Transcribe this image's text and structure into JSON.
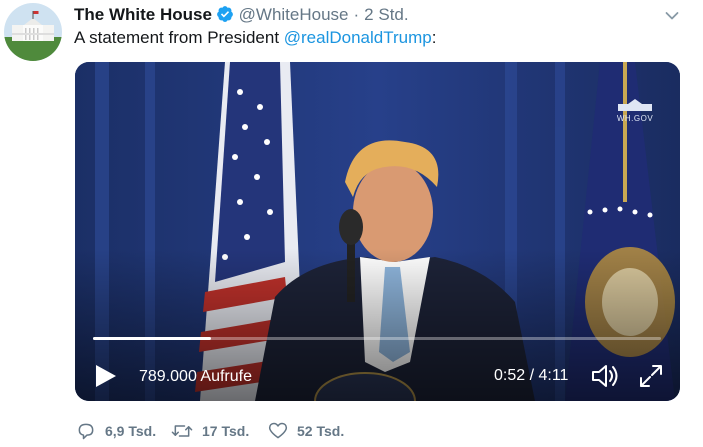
{
  "tweet": {
    "author_name": "The White House",
    "handle": "@WhiteHouse",
    "separator": "·",
    "time": "2 Std.",
    "text_prefix": "A statement from President ",
    "mention": "@realDonaldTrump",
    "text_suffix": ":"
  },
  "video": {
    "views": "789.000 Aufrufe",
    "timecode": "0:52 / 4:11",
    "progress": 0.207,
    "watermark": "WH.GOV"
  },
  "actions": {
    "replies": "6,9 Tsd.",
    "retweets": "17 Tsd.",
    "likes": "52 Tsd."
  },
  "colors": {
    "link": "#1b95e0",
    "secondary_text": "#657786",
    "verified": "#1da1f2"
  },
  "icons": [
    "verified-badge-icon",
    "chevron-down-icon",
    "play-icon",
    "volume-icon",
    "fullscreen-icon",
    "reply-icon",
    "retweet-icon",
    "like-icon"
  ]
}
